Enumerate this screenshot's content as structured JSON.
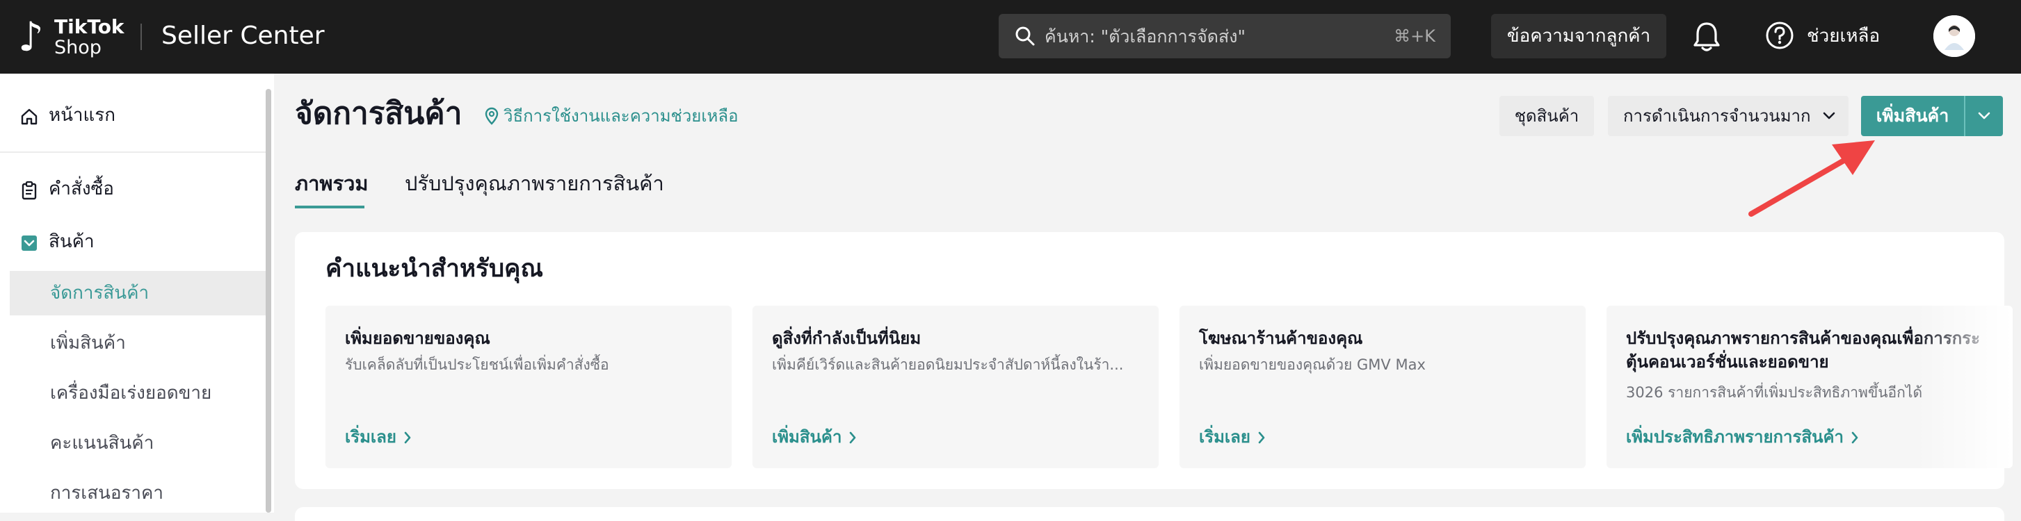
{
  "topbar": {
    "logo_line1": "TikTok",
    "logo_line2": "Shop",
    "app_title": "Seller Center",
    "search_placeholder": "ค้นหา: \"ตัวเลือกการจัดส่ง\"",
    "search_shortcut": "⌘+K",
    "messages_label": "ข้อความจากลูกค้า",
    "help_label": "ช่วยเหลือ"
  },
  "sidebar": {
    "items": [
      {
        "label": "หน้าแรก",
        "icon": "home-icon"
      },
      {
        "label": "คำสั่งซื้อ",
        "icon": "clipboard-icon"
      },
      {
        "label": "สินค้า",
        "icon": "product-icon"
      }
    ],
    "sub_items": [
      {
        "label": "จัดการสินค้า",
        "active": true
      },
      {
        "label": "เพิ่มสินค้า",
        "active": false
      },
      {
        "label": "เครื่องมือเร่งยอดขาย",
        "active": false
      },
      {
        "label": "คะแนนสินค้า",
        "active": false
      },
      {
        "label": "การเสนอราคา",
        "active": false
      }
    ]
  },
  "main": {
    "title": "จัดการสินค้า",
    "help_link": "วิธีการใช้งานและความช่วยเหลือ",
    "bundle_button": "ชุดสินค้า",
    "bulk_button": "การดำเนินการจำนวนมาก",
    "add_button": "เพิ่มสินค้า",
    "tabs": [
      {
        "label": "ภาพรวม",
        "active": true
      },
      {
        "label": "ปรับปรุงคุณภาพรายการสินค้า",
        "active": false
      }
    ],
    "recommend_title": "คำแนะนำสำหรับคุณ",
    "cards": [
      {
        "title": "เพิ่มยอดขายของคุณ",
        "desc": "รับเคล็ดลับที่เป็นประโยชน์เพื่อเพิ่มคำสั่งซื้อ",
        "link": "เริ่มเลย"
      },
      {
        "title": "ดูสิ่งที่กำลังเป็นที่นิยม",
        "desc": "เพิ่มคีย์เวิร์ดและสินค้ายอดนิยมประจำสัปดาห์นี้ลงในร้า...",
        "link": "เพิ่มสินค้า"
      },
      {
        "title": "โฆษณาร้านค้าของคุณ",
        "desc": "เพิ่มยอดขายของคุณด้วย GMV Max",
        "link": "เริ่มเลย"
      },
      {
        "title": "ปรับปรุงคุณภาพรายการสินค้าของคุณเพื่อการกระตุ้นคอนเวอร์ชั่นและยอดขาย",
        "desc": "3026 รายการสินค้าที่เพิ่มประสิทธิภาพขึ้นอีกได้",
        "link": "เพิ่มประสิทธิภาพรายการสินค้า"
      }
    ]
  },
  "colors": {
    "accent": "#3a9a95",
    "topbar": "#1c1c1c",
    "arrow": "#ef4444"
  }
}
